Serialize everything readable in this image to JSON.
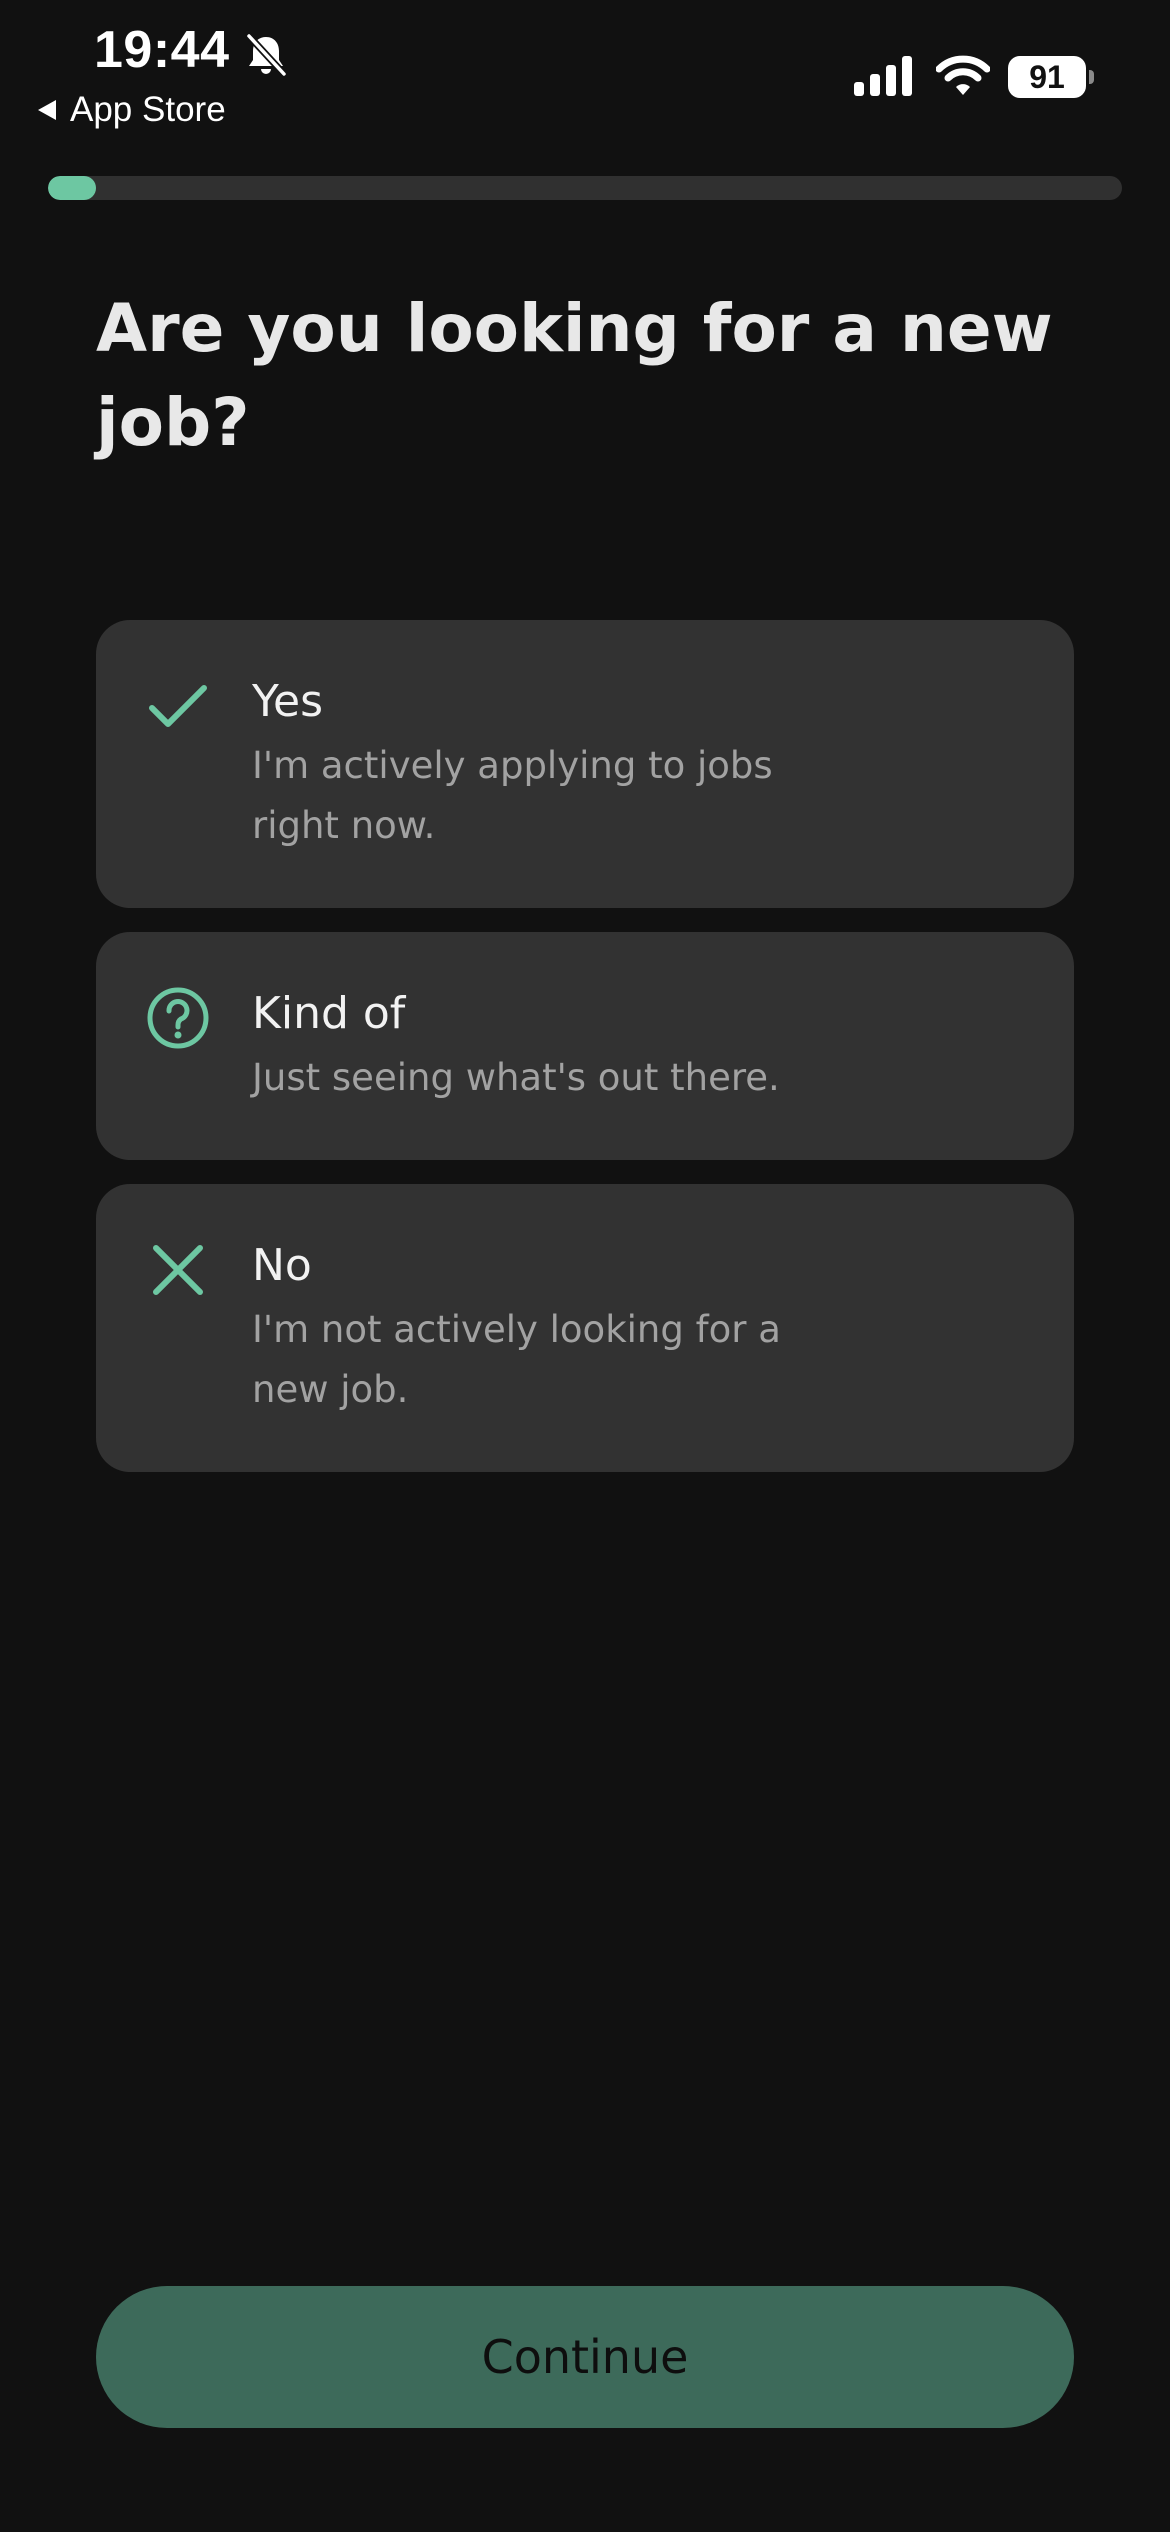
{
  "status_bar": {
    "time": "19:44",
    "back_label": "App Store",
    "battery_level": "91",
    "icons": [
      "bell-slash-icon",
      "back-arrow-icon",
      "cellular-signal-icon",
      "wifi-icon",
      "battery-icon"
    ]
  },
  "progress": {
    "fraction": 0.045
  },
  "question": {
    "title": "Are you looking for a new job?"
  },
  "options": [
    {
      "title": "Yes",
      "description": "I'm actively applying to jobs right now.",
      "icon": "checkmark-icon"
    },
    {
      "title": "Kind of",
      "description": "Just seeing what's out there.",
      "icon": "question-circle-icon"
    },
    {
      "title": "No",
      "description": "I'm not actively looking for a new job.",
      "icon": "x-mark-icon"
    }
  ],
  "continue_label": "Continue",
  "colors": {
    "background": "#111111",
    "card": "#323232",
    "accent": "#6dc7a2",
    "progress_track": "#303030",
    "button": "#3d6a5a",
    "button_text": "#0e0e0e",
    "secondary_text": "#a2a2a2"
  }
}
